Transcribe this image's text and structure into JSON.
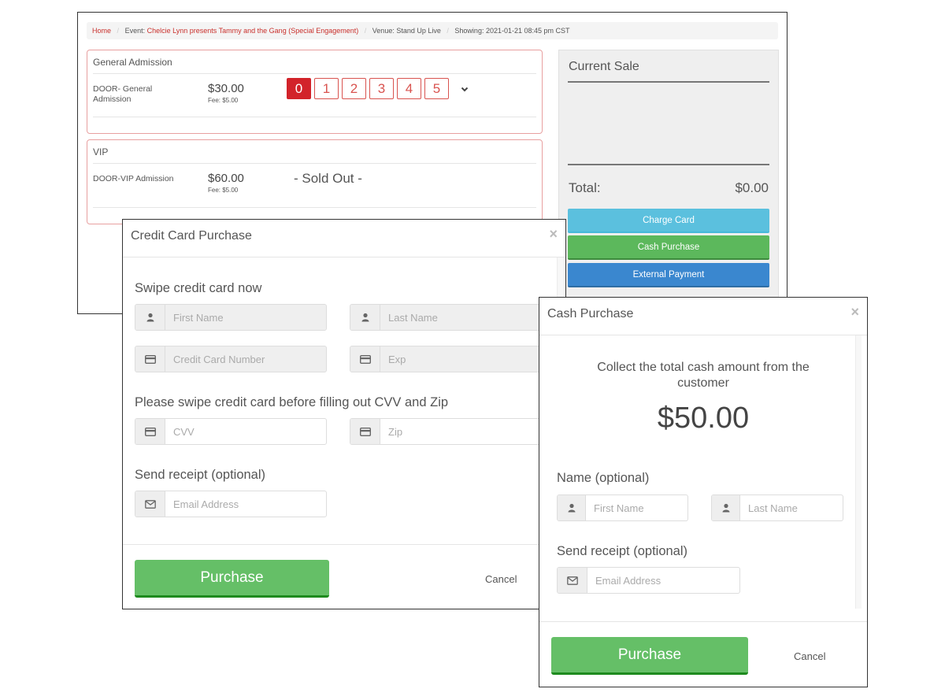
{
  "breadcrumb": {
    "home": "Home",
    "event_prefix": "Event:",
    "event_name": "Chelcie Lynn presents Tammy and the Gang (Special Engagement)",
    "venue": "Venue: Stand Up Live",
    "showing": "Showing: 2021-01-21 08:45 pm CST"
  },
  "ticket_sections": [
    {
      "title": "General Admission",
      "ticket_name": "DOOR- General Admission",
      "price": "$30.00",
      "fee": "Fee: $5.00",
      "quantity_options": [
        "0",
        "1",
        "2",
        "3",
        "4",
        "5"
      ],
      "selected_quantity": "0",
      "more_icon": "chevron-down-icon"
    },
    {
      "title": "VIP",
      "ticket_name": "DOOR-VIP Admission",
      "price": "$60.00",
      "fee": "Fee: $5.00",
      "status": "- Sold Out -"
    }
  ],
  "current_sale": {
    "title": "Current Sale",
    "total_label": "Total:",
    "total_value": "$0.00",
    "buttons": {
      "charge_card": "Charge Card",
      "cash_purchase": "Cash Purchase",
      "external_payment": "External Payment"
    }
  },
  "credit_card_modal": {
    "title": "Credit Card Purchase",
    "close": "×",
    "swipe_label": "Swipe credit card now",
    "first_name_placeholder": "First Name",
    "last_name_placeholder": "Last Name",
    "card_number_placeholder": "Credit Card Number",
    "exp_placeholder": "Exp",
    "cvv_zip_label": "Please swipe credit card before filling out CVV and Zip",
    "cvv_placeholder": "CVV",
    "zip_placeholder": "Zip",
    "receipt_label": "Send receipt (optional)",
    "email_placeholder": "Email Address",
    "purchase_label": "Purchase",
    "cancel_label": "Cancel"
  },
  "cash_modal": {
    "title": "Cash Purchase",
    "close": "×",
    "instructions": "Collect the total cash amount from the customer",
    "amount": "$50.00",
    "name_label": "Name (optional)",
    "first_name_placeholder": "First Name",
    "last_name_placeholder": "Last Name",
    "receipt_label": "Send receipt (optional)",
    "email_placeholder": "Email Address",
    "purchase_label": "Purchase",
    "cancel_label": "Cancel"
  },
  "colors": {
    "accent_red": "#d2232a",
    "charge_blue": "#5bc0de",
    "cash_green": "#5cb85c",
    "external_blue": "#3a87cf",
    "purchase_green": "#65bf67"
  }
}
